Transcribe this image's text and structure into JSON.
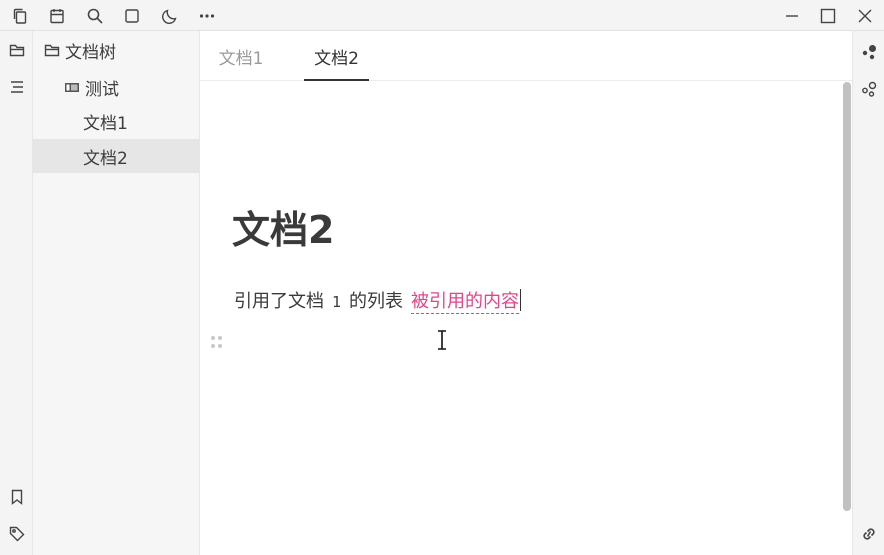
{
  "topbar": {
    "icons": [
      "copy-icon",
      "calendar-icon",
      "search-icon",
      "square-icon",
      "moon-icon",
      "more-icon"
    ],
    "window_controls": [
      "minimize-icon",
      "maximize-icon",
      "close-icon"
    ]
  },
  "left_dock": {
    "icons": [
      "folder-icon",
      "outline-icon",
      "bookmark-icon",
      "tag-icon"
    ]
  },
  "filetree": {
    "root_label": "文档树",
    "notebook_label": "测试",
    "docs": [
      {
        "label": "文档1",
        "selected": false
      },
      {
        "label": "文档2",
        "selected": true
      }
    ]
  },
  "tabs": [
    {
      "label": "文档1",
      "active": false
    },
    {
      "label": "文档2",
      "active": true
    }
  ],
  "document": {
    "title": "文档2",
    "line_prefix": "引用了文档",
    "line_number": "1",
    "line_suffix": "的列表",
    "reference_text": "被引用的内容"
  },
  "right_dock": {
    "icons": [
      "graph-icon",
      "relation-graph-icon",
      "backlink-icon"
    ]
  },
  "colors": {
    "reference": "#e0468a",
    "selected_row": "#e6e6e6",
    "scroll_thumb": "#c1c1c1"
  }
}
